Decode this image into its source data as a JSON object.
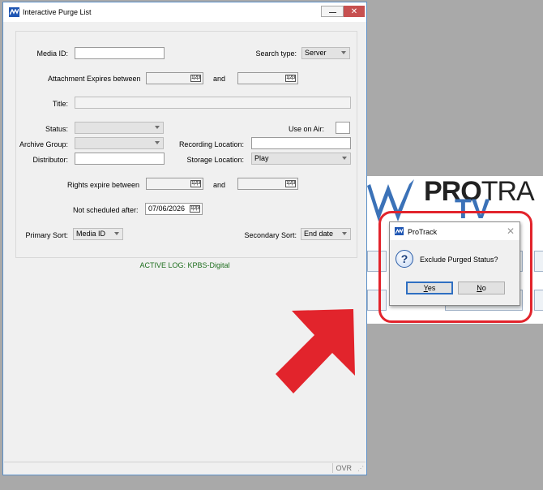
{
  "window": {
    "title": "Interactive Purge List"
  },
  "form": {
    "media_id_label": "Media ID:",
    "media_id_value": "",
    "search_type_label": "Search type:",
    "search_type_value": "Server",
    "attachment_expires_label": "Attachment Expires between",
    "attachment_and_label": "and",
    "title_label": "Title:",
    "status_label": "Status:",
    "use_on_air_label": "Use on Air:",
    "archive_group_label": "Archive Group:",
    "recording_location_label": "Recording Location:",
    "distributor_label": "Distributor:",
    "storage_location_label": "Storage Location:",
    "storage_location_value": "Play",
    "rights_expire_label": "Rights expire between",
    "rights_and_label": "and",
    "not_scheduled_label": "Not scheduled after:",
    "not_scheduled_value": "07/06/2026",
    "primary_sort_label": "Primary Sort:",
    "primary_sort_value": "Media ID",
    "secondary_sort_label": "Secondary Sort:",
    "secondary_sort_value": "End date",
    "calendar_glyph": "1|2|3"
  },
  "active_log": "ACTIVE LOG: KPBS-Digital",
  "status_bar": {
    "mode": "OVR"
  },
  "background_app": {
    "brand_pro": "PRO",
    "brand_tra": "TRA",
    "brand_tv": "TV"
  },
  "dialog": {
    "title": "ProTrack",
    "message": "Exclude Purged Status?",
    "yes_mnemonic": "Y",
    "yes_rest": "es",
    "no_mnemonic": "N",
    "no_rest": "o"
  },
  "colors": {
    "window_border": "#5b8fc7",
    "close_button": "#c75050",
    "active_log_text": "#1e6e1e",
    "annotation_red": "#e2242c",
    "brand_blue": "#3b72b8"
  },
  "icons": {
    "app": "protrack-logo-icon",
    "question": "question-icon",
    "calendar": "calendar-icon"
  }
}
